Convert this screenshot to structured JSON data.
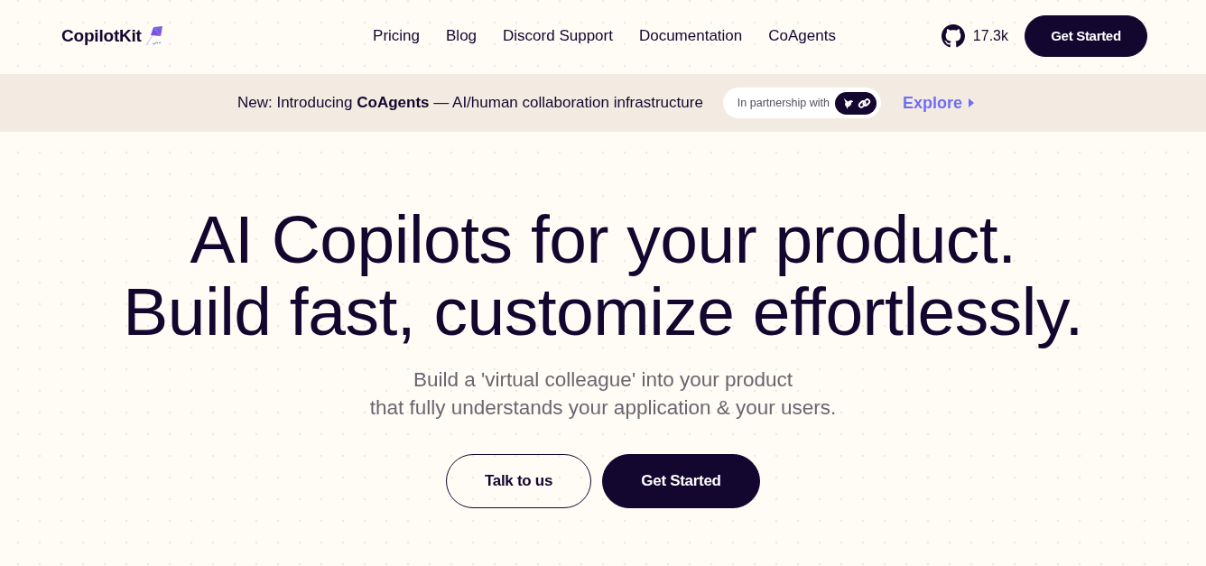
{
  "header": {
    "logo": "CopilotKit",
    "nav_links": [
      "Pricing",
      "Blog",
      "Discord Support",
      "Documentation",
      "CoAgents"
    ],
    "github_stars": "17.3k",
    "cta": "Get Started"
  },
  "announcement": {
    "text": "New: Introducing **CoAgents** — AI/human collaboration infrastructure",
    "partner_label": "In partnership with",
    "link": "Explore"
  },
  "hero": {
    "title_lines": [
      "AI Copilots for your product.",
      "Build fast, customize effortlessly."
    ],
    "subtitle_lines": [
      "Build a 'virtual colleague' into your product",
      "that fully understands your application & your users."
    ],
    "buttons": [
      {
        "label": "Talk to us",
        "kind": "outline"
      },
      {
        "label": "Get Started",
        "kind": "solid"
      }
    ]
  }
}
